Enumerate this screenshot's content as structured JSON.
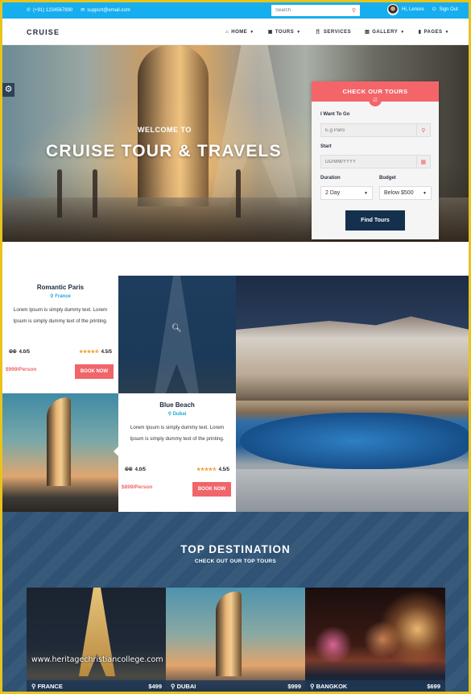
{
  "topbar": {
    "phone": "(+91) 1234567890",
    "email": "support@email.com",
    "search_placeholder": "Search",
    "user_greeting": "Hi, Lenore",
    "signout_label": "Sign Out"
  },
  "nav": {
    "brand": "CRUISE",
    "items": [
      {
        "label": "HOME",
        "icon": "home-icon",
        "dropdown": true
      },
      {
        "label": "TOURS",
        "icon": "briefcase-icon",
        "dropdown": true
      },
      {
        "label": "SERVICES",
        "icon": "cutlery-icon",
        "dropdown": false
      },
      {
        "label": "GALLERY",
        "icon": "image-icon",
        "dropdown": true
      },
      {
        "label": "PAGES",
        "icon": "file-icon",
        "dropdown": true
      }
    ]
  },
  "hero": {
    "welcome": "WELCOME TO",
    "title": "CRUISE TOUR & TRAVELS"
  },
  "booking": {
    "header": "CHECK OUR TOURS",
    "destination_label": "I Want To Go",
    "destination_placeholder": "E.g Paris",
    "start_label": "Start",
    "start_placeholder": "DD/MM/YYYY",
    "duration_label": "Duration",
    "duration_value": "2 Day",
    "budget_label": "Budget",
    "budget_value": "Below $500",
    "submit_label": "Find Tours"
  },
  "tours": [
    {
      "name": "Romantic Paris",
      "location": "France",
      "description": "Lorem Ipsum is simply dummy text. Lorem Ipsum is simply dummy text of the printing.",
      "tripadvisor_rating": "4.0/5",
      "star_rating": "4.5/5",
      "stars": 4.5,
      "price": "$999/Person",
      "book_label": "BOOK NOW"
    },
    {
      "name": "Blue Beach",
      "location": "Dubai",
      "description": "Lorem Ipsum is simply dummy text. Lorem Ipsum is simply dummy text of the printing.",
      "tripadvisor_rating": "4.0/5",
      "star_rating": "4.5/5",
      "stars": 4.5,
      "price": "$899/Person",
      "book_label": "BOOK NOW"
    }
  ],
  "destinations": {
    "title": "TOP DESTINATION",
    "subtitle": "CHECK OUT OUR TOP TOURS",
    "items": [
      {
        "name": "FRANCE",
        "price": "$499"
      },
      {
        "name": "DUBAI",
        "price": "$999"
      },
      {
        "name": "BANGKOK",
        "price": "$699"
      }
    ]
  },
  "watermark": "www.heritagechristiancollege.com",
  "colors": {
    "topbar": "#17aeef",
    "accent": "#f4656a",
    "navy": "#14304d",
    "location": "#1aa8d6",
    "frame": "#e8c31c"
  }
}
